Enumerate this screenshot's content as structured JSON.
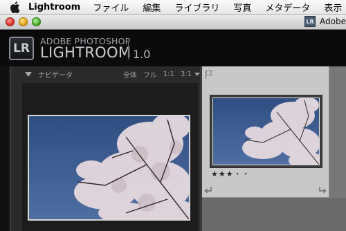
{
  "menubar": {
    "app_name": "Lightroom",
    "items": [
      "ファイル",
      "編集",
      "ライブラリ",
      "写真",
      "メタデータ",
      "表示"
    ]
  },
  "titlebar": {
    "right_icon_text": "LR",
    "right_text": "Adobe"
  },
  "identity": {
    "badge": "LR",
    "line1": "ADOBE PHOTOSHOP",
    "line2": "LIGHTROOM",
    "version": "1.0"
  },
  "navigator": {
    "title": "ナビゲータ",
    "options": [
      "全体",
      "フル",
      "1:1",
      "3:1"
    ]
  },
  "grid": {
    "rating_text": "★★★・・",
    "rating_value": 3,
    "rating_max": 5
  },
  "colors": {
    "sky": "#3f5f8f",
    "blossom": "#e8dde2",
    "panel": "#2a2a2a",
    "cell": "#c8c8c8"
  },
  "icons": {
    "apple": "apple-icon",
    "flag": "flag-icon",
    "rotate_left": "rotate-left-icon",
    "rotate_right": "rotate-right-icon",
    "disclosure": "disclosure-triangle-icon"
  }
}
